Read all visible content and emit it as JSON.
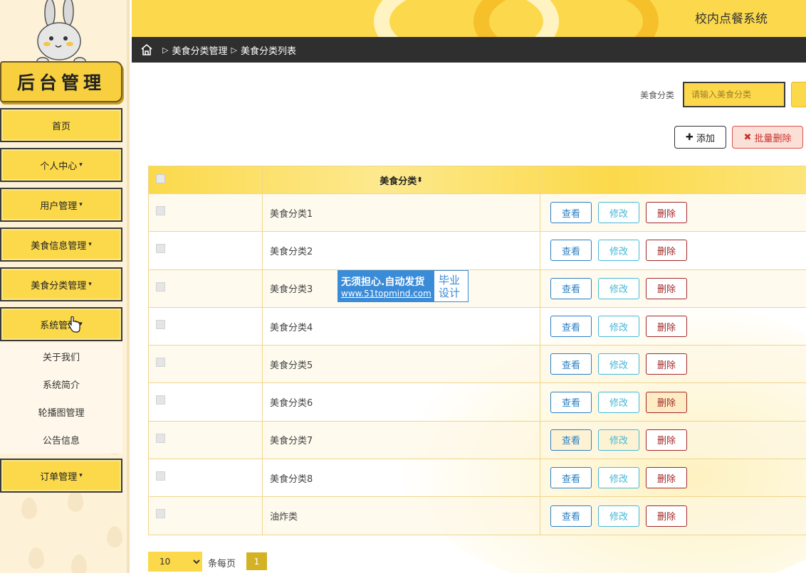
{
  "sidebar": {
    "title": "后台管理",
    "menu": [
      {
        "label": "首页",
        "caret": ""
      },
      {
        "label": "个人中心",
        "caret": "▾"
      },
      {
        "label": "用户管理",
        "caret": "▾"
      },
      {
        "label": "美食信息管理",
        "caret": "▾"
      },
      {
        "label": "美食分类管理",
        "caret": "▾"
      },
      {
        "label": "系统管理",
        "caret": "▾"
      },
      {
        "label": "订单管理",
        "caret": "▾"
      }
    ],
    "submenu": [
      "关于我们",
      "系统简介",
      "轮播图管理",
      "公告信息"
    ]
  },
  "header": {
    "app_title": "校内点餐系统"
  },
  "breadcrumb": {
    "sep": "▷",
    "level1": "美食分类管理",
    "level2": "美食分类列表"
  },
  "search": {
    "label": "美食分类",
    "placeholder": "请输入美食分类"
  },
  "toolbar": {
    "add_icon": "✚",
    "add_label": "添加",
    "delete_icon": "✖",
    "batch_delete_label": "批量删除"
  },
  "table": {
    "header": {
      "name": "美食分类",
      "sort_icon": "⬍"
    },
    "actions": {
      "view": "查看",
      "edit": "修改",
      "delete": "删除"
    },
    "rows": [
      "美食分类1",
      "美食分类2",
      "美食分类3",
      "美食分类4",
      "美食分类5",
      "美食分类6",
      "美食分类7",
      "美食分类8",
      "油炸类"
    ]
  },
  "watermark": {
    "line1": "无须担心.自动发货",
    "line2": "www.51topmind.com",
    "right1": "毕业",
    "right2": "设计"
  },
  "pagination": {
    "page_size": "10",
    "page_size_arrow": "⌄",
    "per_page_label": "条每页",
    "current_page": "1"
  },
  "colors": {
    "accent": "#fbd94a",
    "dark": "#2f2f2f",
    "view": "#2a7fc3",
    "edit": "#45b8d6",
    "delete": "#a42626"
  }
}
